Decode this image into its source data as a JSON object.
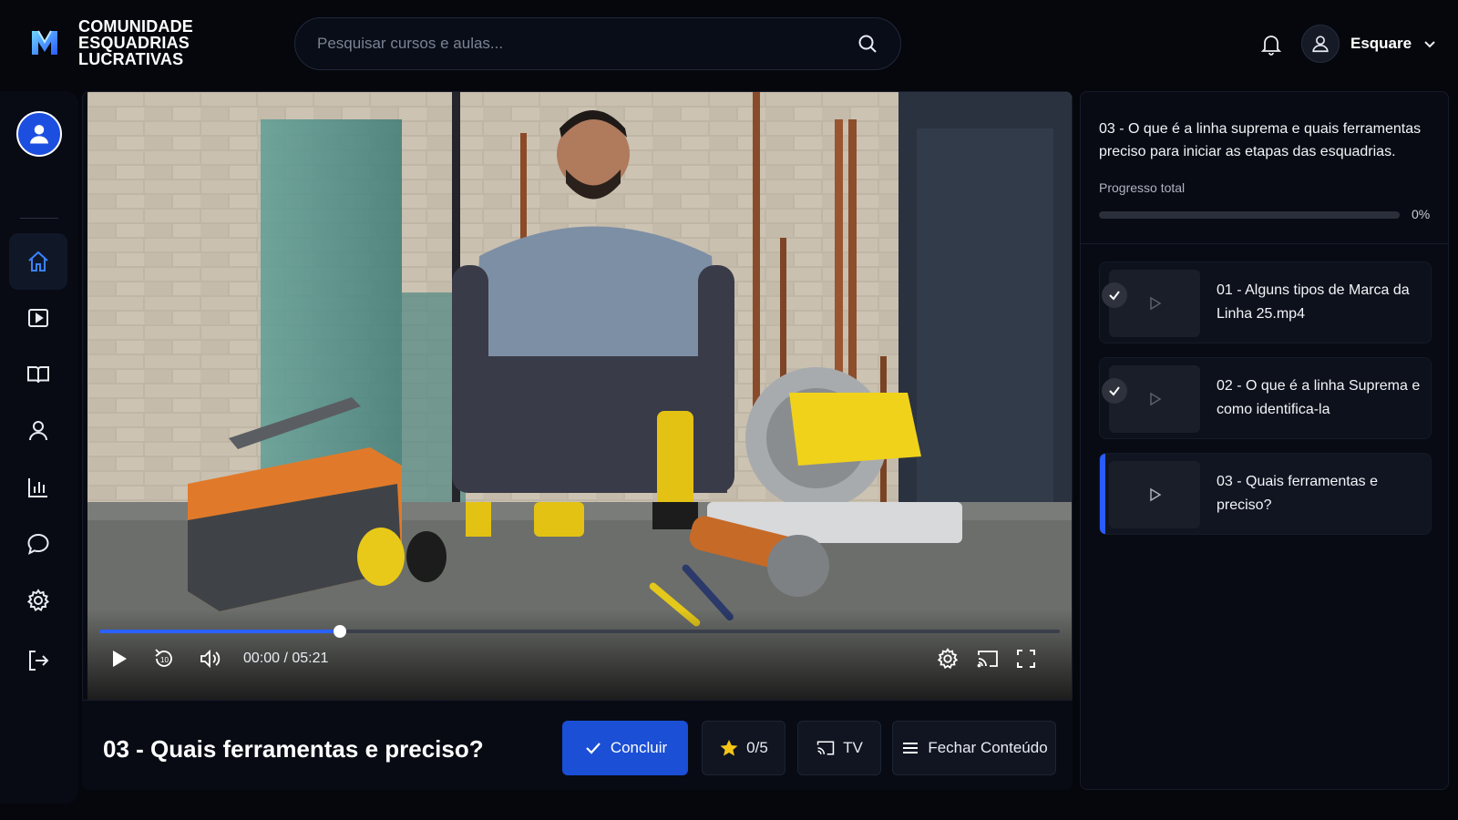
{
  "brand": {
    "line1": "COMUNIDADE",
    "line2": "ESQUADRIAS",
    "line3": "LUCRATIVAS"
  },
  "search": {
    "placeholder": "Pesquisar cursos e aulas...",
    "value": ""
  },
  "user": {
    "name": "Esquare"
  },
  "sidebar": {
    "items": [
      {
        "icon": "home-icon",
        "active": true
      },
      {
        "icon": "play-square-icon",
        "active": false
      },
      {
        "icon": "book-open-icon",
        "active": false
      },
      {
        "icon": "person-icon",
        "active": false
      },
      {
        "icon": "bar-chart-icon",
        "active": false
      },
      {
        "icon": "chat-bubble-icon",
        "active": false
      },
      {
        "icon": "gear-icon",
        "active": false
      },
      {
        "icon": "logout-icon",
        "active": false
      }
    ]
  },
  "player": {
    "time": "00:00 / 05:21",
    "progress_fraction": 0.25
  },
  "lesson": {
    "title": "03 - Quais ferramentas e preciso?",
    "complete_label": "Concluir",
    "rating_label": "0/5",
    "tv_label": "TV",
    "close_label": "Fechar Conteúdo"
  },
  "panel": {
    "title": "03 - O que é a linha suprema e quais ferramentas preciso para iniciar as etapas das esquadrias.",
    "progress_label": "Progresso total",
    "progress_pct": "0%",
    "progress_value": 0,
    "lessons": [
      {
        "title": "01 - Alguns tipos de Marca da Linha 25.mp4",
        "done": true,
        "current": false
      },
      {
        "title": "02 - O que é a linha Suprema e como identifica-la",
        "done": true,
        "current": false
      },
      {
        "title": "03 - Quais ferramentas e preciso?",
        "done": false,
        "current": true
      }
    ]
  },
  "colors": {
    "accent": "#2a5bff",
    "primary_button": "#1a4fd6",
    "background": "#05070d",
    "star": "#f5c518"
  }
}
